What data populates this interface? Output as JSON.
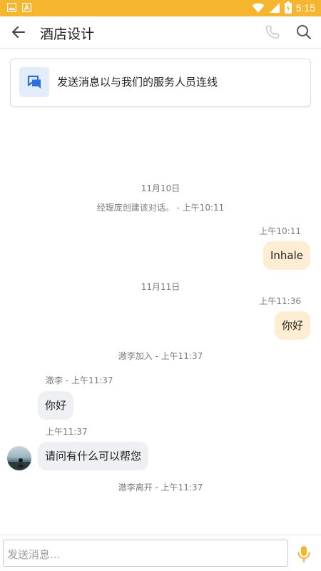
{
  "status_bar": {
    "time": "5:15",
    "icons": [
      "image-icon",
      "a-icon",
      "wifi-icon",
      "signal-icon",
      "battery-icon"
    ],
    "color": "#F5B52E"
  },
  "app_bar": {
    "title": "酒店设计",
    "icons": [
      "back-arrow-icon",
      "phone-icon",
      "search-icon"
    ]
  },
  "connect_card": {
    "text": "发送消息以与我们的服务人员连线",
    "icon": "chat-bubbles-icon"
  },
  "messages": {
    "date1": "11月10日",
    "created": "经理庞创建该对话。 - 上午10:11",
    "out1_time": "上午10:11",
    "out1_text": "Inhale",
    "date2": "11月11日",
    "out2_time": "上午11:36",
    "out2_text": "你好",
    "joined": "澈李加入 - 上午11:37",
    "in1_sender": "澈李 - 上午11:37",
    "in1_text": "你好",
    "in2_time": "上午11:37",
    "in2_text": "请问有什么可以帮您",
    "left": "澈李离开 - 上午11:37"
  },
  "composer": {
    "placeholder": "发送消息...",
    "mic_icon": "microphone-icon",
    "accent": "#F5B52E"
  }
}
